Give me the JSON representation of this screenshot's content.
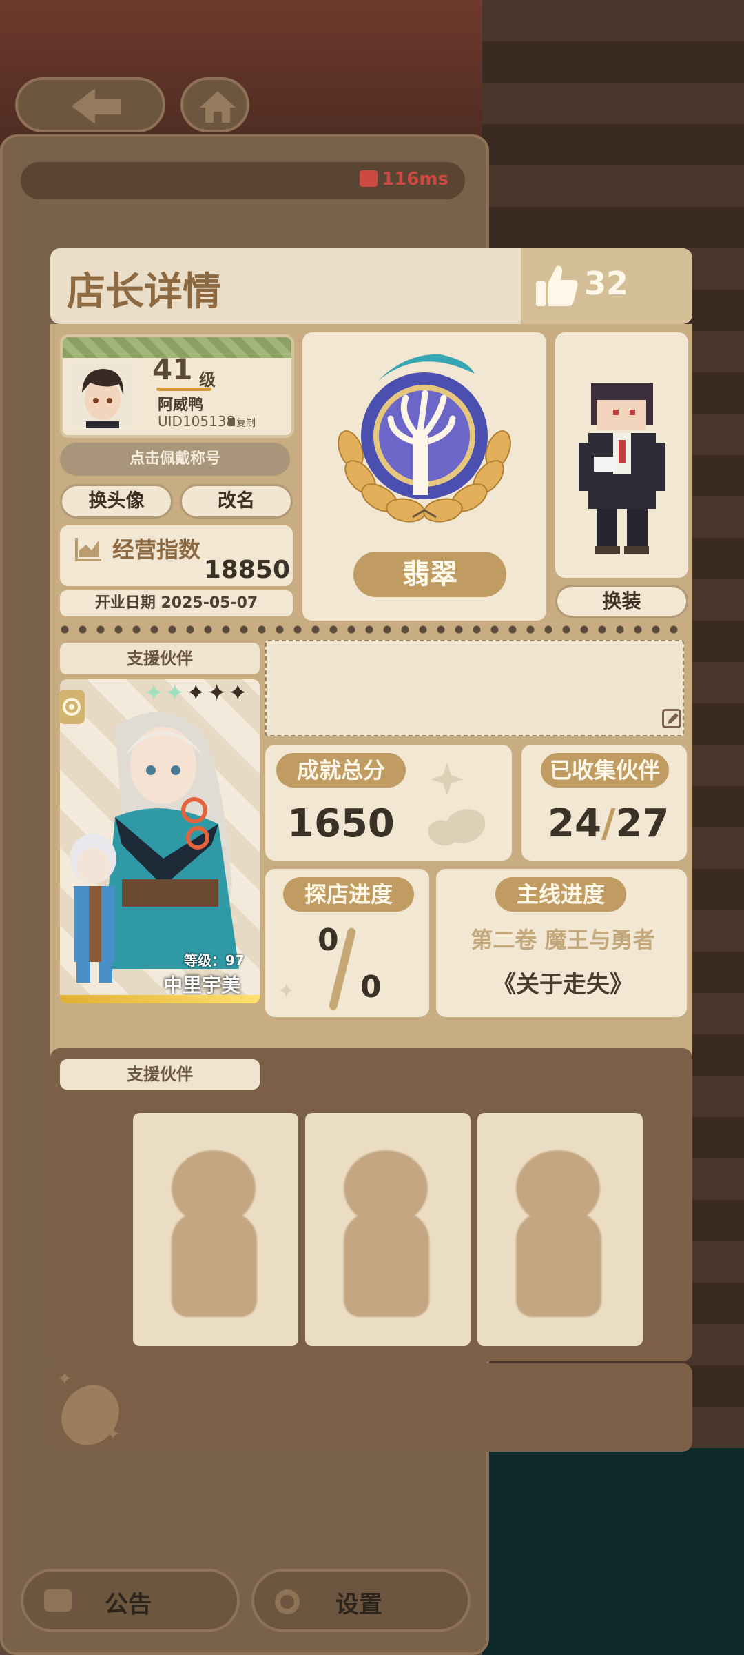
{
  "network": {
    "latency": "116ms"
  },
  "nav": {
    "back_icon": "back-arrow-icon",
    "home_icon": "home-icon"
  },
  "bottom_bar": {
    "notice_label": "公告",
    "settings_label": "设置"
  },
  "dialog": {
    "title": "店长详情",
    "likes": "32",
    "profile": {
      "level": "41",
      "level_unit": "级",
      "name": "阿威鸭",
      "uid": "UID105138",
      "copy_label": "复制",
      "title_placeholder": "点击佩戴称号",
      "change_avatar_label": "换头像",
      "rename_label": "改名",
      "business_index_label": "经营指数",
      "business_index_value": "18850",
      "open_date_label": "开业日期",
      "open_date_value": "2025-05-07"
    },
    "badge": {
      "name": "翡翠"
    },
    "outfit": {
      "change_label": "换装"
    },
    "support": {
      "tag": "支援伙伴",
      "partner": {
        "stars_lit": 2,
        "stars_total": 5,
        "level_label": "等级：97",
        "name": "中里宇美"
      }
    },
    "stats": {
      "achievement_label": "成就总分",
      "achievement_value": "1650",
      "collected_label": "已收集伙伴",
      "collected_value": "24",
      "collected_total": "27",
      "explore_label": "探店进度",
      "explore_value": "0",
      "explore_total": "0",
      "main_label": "主线进度",
      "main_chapter": "第二卷 魔王与勇者",
      "main_subtitle": "《关于走失》"
    },
    "lower": {
      "tag": "支援伙伴",
      "slots": 3
    }
  },
  "colors": {
    "accent_brown": "#c09b62",
    "panel": "#f2e7d3",
    "title_text": "#8e6a42",
    "latency_red": "#cc4a42"
  }
}
